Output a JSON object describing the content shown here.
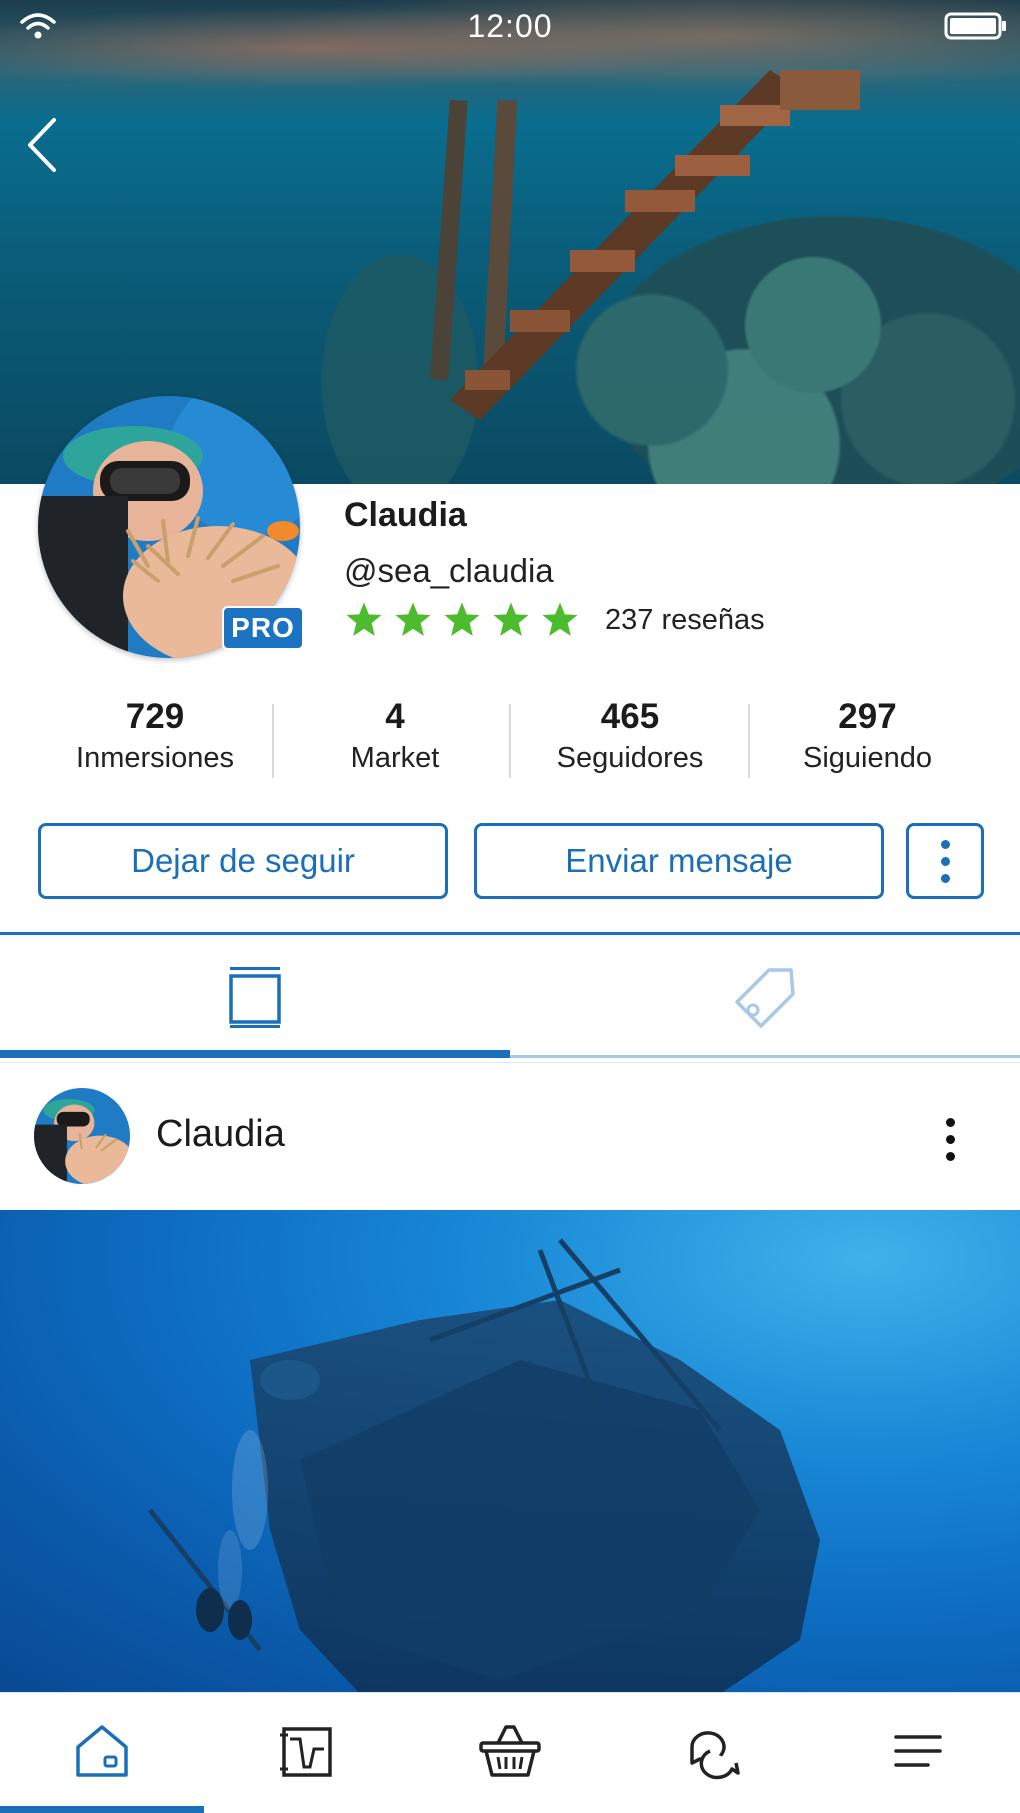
{
  "status_bar": {
    "time": "12:00"
  },
  "profile": {
    "name": "Claudia",
    "handle": "@sea_claudia",
    "badge": "PRO",
    "rating_stars": 5,
    "reviews": "237 reseñas"
  },
  "stats": [
    {
      "value": "729",
      "label": "Inmersiones"
    },
    {
      "value": "4",
      "label": "Market"
    },
    {
      "value": "465",
      "label": "Seguidores"
    },
    {
      "value": "297",
      "label": "Siguiendo"
    }
  ],
  "actions": {
    "unfollow_label": "Dejar de seguir",
    "message_label": "Enviar mensaje"
  },
  "tabs": [
    {
      "icon": "posts-icon",
      "active": true
    },
    {
      "icon": "tag-icon",
      "active": false
    }
  ],
  "post": {
    "author": "Claudia"
  },
  "bottom_nav": [
    {
      "icon": "home-icon",
      "active": true
    },
    {
      "icon": "dive-log-icon",
      "active": false
    },
    {
      "icon": "basket-icon",
      "active": false
    },
    {
      "icon": "chat-icon",
      "active": false
    },
    {
      "icon": "menu-icon",
      "active": false
    }
  ],
  "colors": {
    "accent": "#1a6fb8",
    "star": "#4cbb2e",
    "badge": "#1b73c2",
    "inactive_tab": "#a8c8e6"
  }
}
